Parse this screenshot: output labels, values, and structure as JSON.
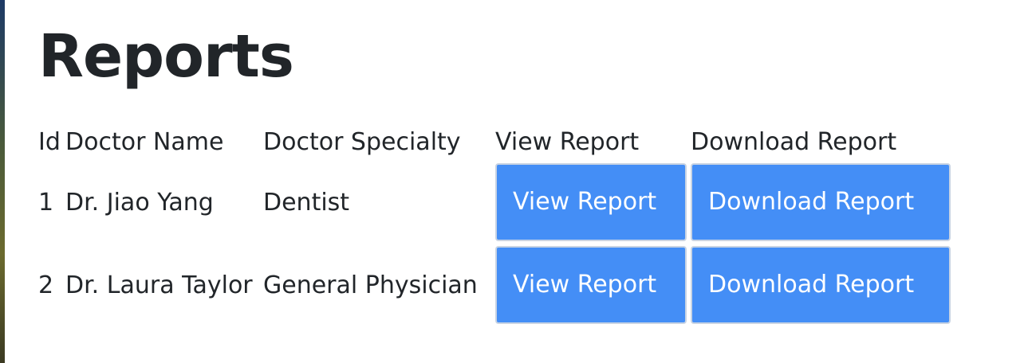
{
  "page": {
    "title": "Reports"
  },
  "table": {
    "headers": [
      "Id",
      "Doctor Name",
      "Doctor Specialty",
      "View Report",
      "Download Report"
    ],
    "rows": [
      {
        "id": "1",
        "doctor_name": "Dr. Jiao Yang",
        "specialty": "Dentist",
        "view_label": "View Report",
        "download_label": "Download Report"
      },
      {
        "id": "2",
        "doctor_name": "Dr. Laura Taylor",
        "specialty": "General Physician",
        "view_label": "View Report",
        "download_label": "Download Report"
      }
    ]
  },
  "colors": {
    "button_bg": "#448ef6",
    "button_text": "#ffffff",
    "text": "#212529"
  }
}
